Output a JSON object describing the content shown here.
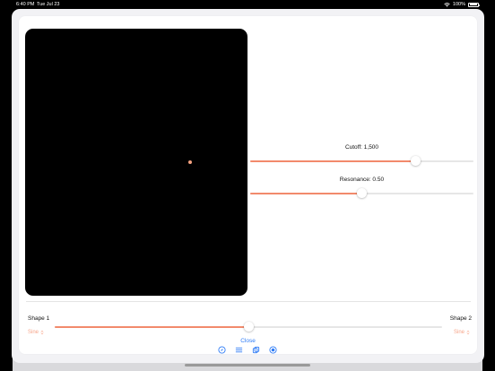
{
  "status_bar": {
    "time": "6:40 PM",
    "date": "Tue Jul 23",
    "battery": "100%"
  },
  "cutoff": {
    "label": "Cutoff: 1,500",
    "fraction": 0.74
  },
  "resonance": {
    "label": "Resonance: 0.50",
    "fraction": 0.5
  },
  "shape1": {
    "title": "Shape 1",
    "value": "Sine"
  },
  "shape2": {
    "title": "Shape 2",
    "value": "Sine"
  },
  "morph": {
    "fraction": 0.5
  },
  "close_label": "Close",
  "toolbar": {
    "icons": [
      "compass-icon",
      "sliders-icon",
      "copy-icon",
      "record-icon"
    ]
  },
  "colors": {
    "accent": "#f28a6c",
    "link": "#2f7cf6",
    "pad": "#000000",
    "dot": "#f4a180"
  }
}
